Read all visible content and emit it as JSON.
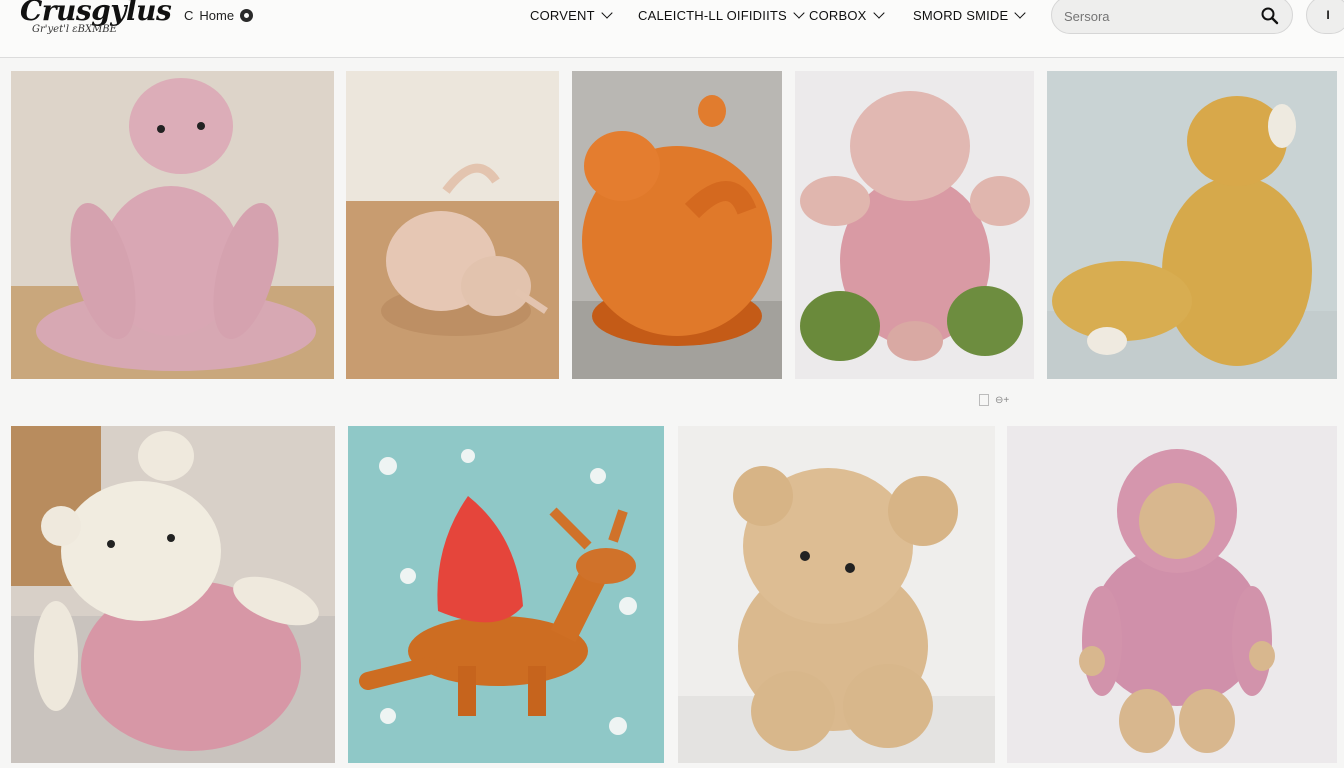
{
  "header": {
    "logo_title": "Crusgylus",
    "logo_tagline": "Gr'yet'l ɛBXMBE",
    "home_label": "Home",
    "home_back_glyph": "C",
    "nav": [
      {
        "label": "CORVENT"
      },
      {
        "label": "CALEICTH-LL OIFIDIITS"
      },
      {
        "label": "CORBOX"
      },
      {
        "label": "SMORD SMIDE"
      }
    ],
    "search_placeholder": "Sersora",
    "user_label": "I"
  },
  "gallery": {
    "items": [
      {
        "subject": "pink crochet sitting figure"
      },
      {
        "subject": "beige crochet curled creature"
      },
      {
        "subject": "orange crochet bird"
      },
      {
        "subject": "pink crochet creature with green feet"
      },
      {
        "subject": "yellow crochet duck"
      },
      {
        "subject": "white and pink crochet bear"
      },
      {
        "subject": "orange crochet deer with red hat"
      },
      {
        "subject": "beige crochet teddy bear"
      },
      {
        "subject": "pink crochet hooded doll"
      }
    ],
    "pager_label": "⊖+"
  },
  "colors": {
    "background": "#f6f6f5",
    "topbar": "#fbfbfa",
    "search_bg": "#eeeeed"
  }
}
